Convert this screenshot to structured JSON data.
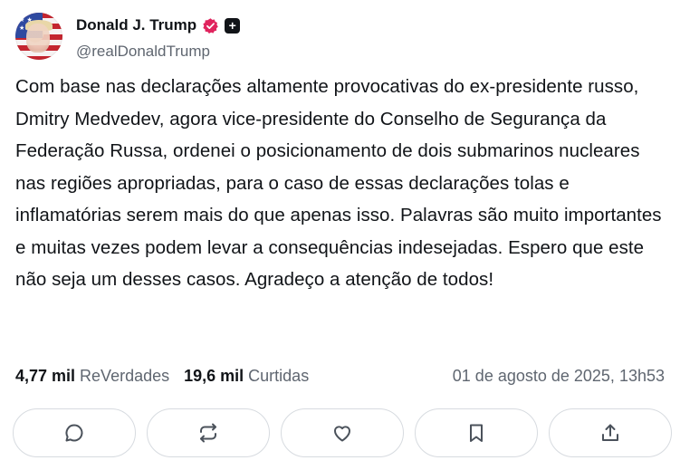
{
  "author": {
    "name": "Donald J. Trump",
    "handle": "@realDonaldTrump",
    "verified_color": "#e0245e",
    "plus_badge": "+"
  },
  "post": {
    "text": "Com base nas declarações altamente provocativas do ex-presidente russo, Dmitry Medvedev, agora vice-presidente do Conselho de Segurança da Federação Russa, ordenei o posicionamento de dois submarinos nucleares nas regiões apropriadas, para o caso de essas declarações tolas e inflamatórias serem mais do que apenas isso. Palavras são muito importantes e muitas vezes podem levar a consequências indesejadas. Espero que este não seja um desses casos. Agradeço a atenção de todos!"
  },
  "stats": {
    "retruths_count": "4,77 mil",
    "retruths_label": "ReVerdades",
    "likes_count": "19,6 mil",
    "likes_label": "Curtidas",
    "date": "01 de agosto de 2025, 13h53"
  },
  "actions": [
    {
      "icon": "reply-icon"
    },
    {
      "icon": "retruth-icon"
    },
    {
      "icon": "like-icon"
    },
    {
      "icon": "bookmark-icon"
    },
    {
      "icon": "share-icon"
    }
  ]
}
